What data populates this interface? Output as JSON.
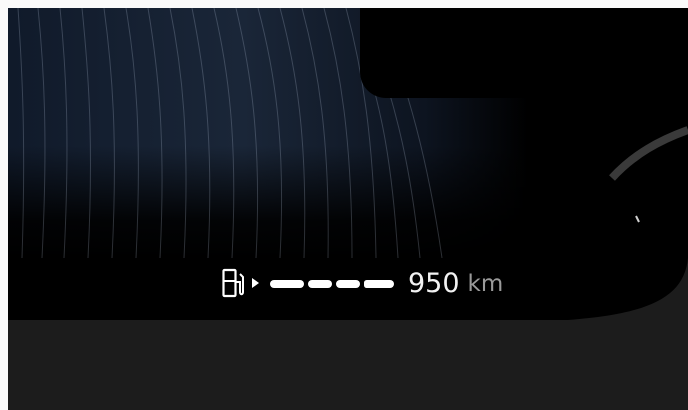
{
  "range_display": {
    "icon": "fuel-pump-icon",
    "segments_filled": 4,
    "value": "950",
    "unit": "km"
  },
  "colors": {
    "background": "#000000",
    "texture_tint": "#1a2638",
    "text_primary": "#f2f2f2",
    "text_secondary": "#9a9a9a",
    "bezel": "#1c1c1c"
  }
}
